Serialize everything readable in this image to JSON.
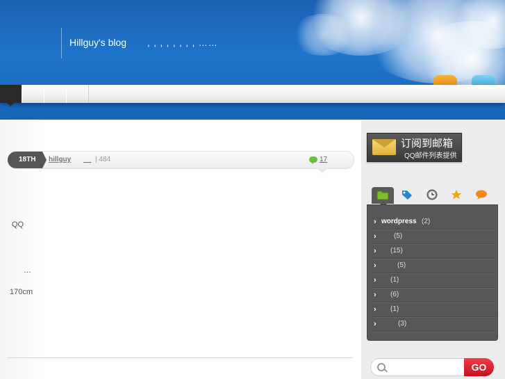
{
  "header": {
    "site_title": "Hillguy's blog",
    "site_description": ",     , , , , , , , ……"
  },
  "nav": {
    "home_label": "",
    "tabs": [
      "",
      "",
      ""
    ]
  },
  "post": {
    "date": "18TH",
    "author": "hillguy",
    "category": "__",
    "views": "| 484",
    "comments": "17",
    "body": [
      "QQ",
      "…",
      "170cm"
    ]
  },
  "sidebar": {
    "subscribe_title": "订阅到邮箱",
    "subscribe_subtitle": "QQ邮件列表提供",
    "tabs": [
      {
        "icon": "folder-icon",
        "color": "#7dbb2f"
      },
      {
        "icon": "tag-icon",
        "color": "#2d86d4"
      },
      {
        "icon": "clock-icon",
        "color": "#777777"
      },
      {
        "icon": "star-icon",
        "color": "#f0a020"
      },
      {
        "icon": "speech-bubble-icon",
        "color": "#f08a20"
      }
    ],
    "categories": [
      {
        "name": "wordpress",
        "count": "(2)"
      },
      {
        "name": "",
        "count": "(5)"
      },
      {
        "name": "",
        "count": "(15)"
      },
      {
        "name": "",
        "count": "(5)"
      },
      {
        "name": "",
        "count": "(1)"
      },
      {
        "name": "",
        "count": "(6)"
      },
      {
        "name": "",
        "count": "(1)"
      },
      {
        "name": "",
        "count": "(3)"
      }
    ],
    "search_placeholder": "",
    "go_label": "GO"
  }
}
